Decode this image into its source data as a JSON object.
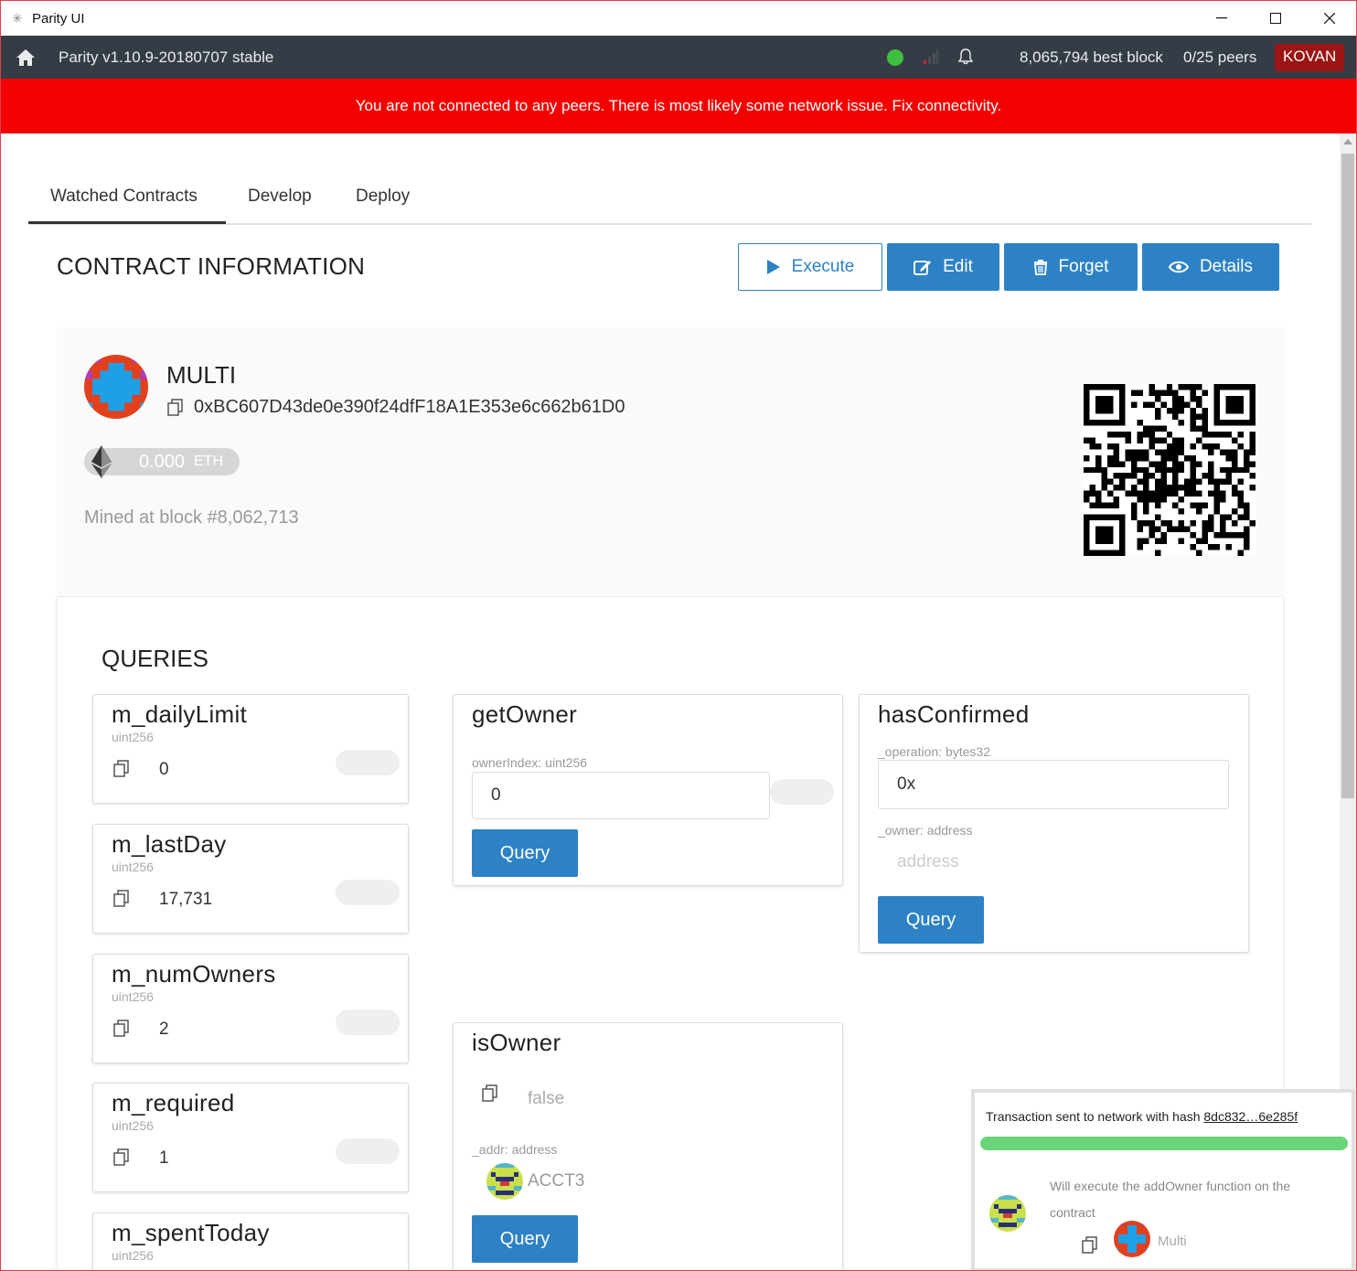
{
  "window": {
    "title": "Parity UI",
    "minimize_glyph": "—",
    "maximize_glyph": "☐",
    "close_glyph": "✕"
  },
  "statusbar": {
    "version": "Parity v1.10.9-20180707 stable",
    "best_block": "8,065,794 best block",
    "peers": "0/25 peers",
    "chain": "KOVAN"
  },
  "warning": {
    "text": "You are not connected to any peers. There is most likely some network issue. Fix connectivity."
  },
  "tabs": [
    {
      "label": "Watched Contracts",
      "active": true
    },
    {
      "label": "Develop",
      "active": false
    },
    {
      "label": "Deploy",
      "active": false
    }
  ],
  "contract_section": {
    "title": "CONTRACT INFORMATION",
    "buttons": {
      "execute": "Execute",
      "edit": "Edit",
      "forget": "Forget",
      "details": "Details"
    }
  },
  "contract": {
    "name": "MULTI",
    "address": "0xBC607D43de0e390f24dfF18A1E353e6c662b61D0",
    "balance": "0.000",
    "balance_unit": "ETH",
    "mined": "Mined at block #8,062,713"
  },
  "queries": {
    "title": "QUERIES",
    "constants": [
      {
        "name": "m_dailyLimit",
        "type": "uint256",
        "value": "0"
      },
      {
        "name": "m_lastDay",
        "type": "uint256",
        "value": "17,731"
      },
      {
        "name": "m_numOwners",
        "type": "uint256",
        "value": "2"
      },
      {
        "name": "m_required",
        "type": "uint256",
        "value": "1"
      },
      {
        "name": "m_spentToday",
        "type": "uint256",
        "value": ""
      }
    ],
    "getOwner": {
      "name": "getOwner",
      "param_label": "ownerIndex: uint256",
      "param_value": "0",
      "button": "Query"
    },
    "hasConfirmed": {
      "name": "hasConfirmed",
      "param1_label": "_operation: bytes32",
      "param1_value": "0x",
      "param2_label": "_owner: address",
      "param2_placeholder": "address",
      "button": "Query"
    },
    "isOwner": {
      "name": "isOwner",
      "result": "false",
      "param_label": "_addr: address",
      "param_value": "ACCT3",
      "button": "Query"
    }
  },
  "toast": {
    "prefix": "Transaction sent to network with hash ",
    "hash": "8dc832…6e285f",
    "exec_text": "Will execute the  addOwner  function on the contract",
    "contract_label": "Multi",
    "progress_fraction": 1.0
  },
  "colors": {
    "primary": "#2d82c6",
    "warning_bg": "#f40000",
    "statusbar_bg": "#353c46",
    "chain_badge": "#9b1515",
    "progress": "#6bd47b"
  }
}
